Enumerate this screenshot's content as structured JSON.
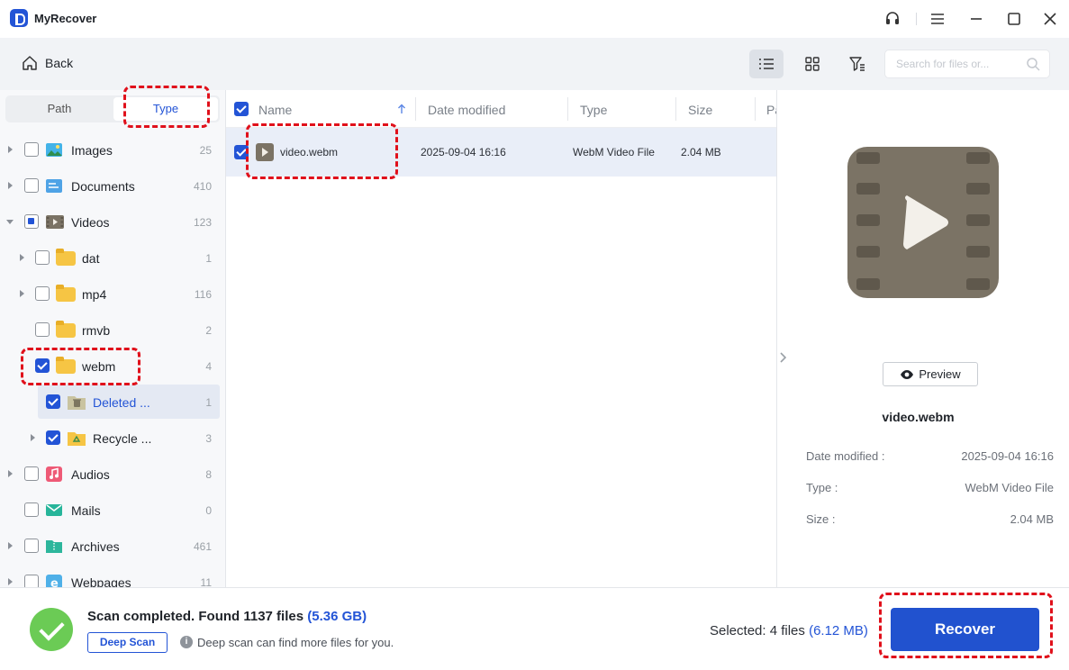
{
  "app": {
    "title": "MyRecover"
  },
  "toolbar": {
    "back_label": "Back",
    "search_placeholder": "Search for files or..."
  },
  "sidebar": {
    "tabs": [
      {
        "label": "Path",
        "active": false
      },
      {
        "label": "Type",
        "active": true
      }
    ],
    "items": [
      {
        "label": "Images",
        "count": "25",
        "icon": "images-icon",
        "level": 0,
        "checked": "none",
        "expanded": false
      },
      {
        "label": "Documents",
        "count": "410",
        "icon": "documents-icon",
        "level": 0,
        "checked": "none",
        "expanded": false
      },
      {
        "label": "Videos",
        "count": "123",
        "icon": "videos-icon",
        "level": 0,
        "checked": "partial",
        "expanded": true
      },
      {
        "label": "dat",
        "count": "1",
        "icon": "folder-icon",
        "level": 1,
        "checked": "none",
        "expanded": false
      },
      {
        "label": "mp4",
        "count": "116",
        "icon": "folder-icon",
        "level": 1,
        "checked": "none",
        "expanded": false
      },
      {
        "label": "rmvb",
        "count": "2",
        "icon": "folder-icon",
        "level": 1,
        "checked": "none",
        "expanded": false
      },
      {
        "label": "webm",
        "count": "4",
        "icon": "folder-icon",
        "level": 1,
        "checked": "checked",
        "expanded": true
      },
      {
        "label": "Deleted ...",
        "count": "1",
        "icon": "deleted-folder-icon",
        "level": 2,
        "checked": "checked",
        "selected": true
      },
      {
        "label": "Recycle ...",
        "count": "3",
        "icon": "recycle-folder-icon",
        "level": 2,
        "checked": "checked",
        "expanded": false
      },
      {
        "label": "Audios",
        "count": "8",
        "icon": "audios-icon",
        "level": 0,
        "checked": "none",
        "expanded": false
      },
      {
        "label": "Mails",
        "count": "0",
        "icon": "mails-icon",
        "level": 0,
        "checked": "none"
      },
      {
        "label": "Archives",
        "count": "461",
        "icon": "archives-icon",
        "level": 0,
        "checked": "none",
        "expanded": false
      },
      {
        "label": "Webpages",
        "count": "11",
        "icon": "webpages-icon",
        "level": 0,
        "checked": "none",
        "expanded": false
      }
    ]
  },
  "file_list": {
    "columns": [
      "Name",
      "Date modified",
      "Type",
      "Size",
      "Pa"
    ],
    "rows": [
      {
        "name": "video.webm",
        "date": "2025-09-04 16:16",
        "type": "WebM Video File",
        "size": "2.04 MB",
        "checked": true
      }
    ]
  },
  "preview": {
    "button_label": "Preview",
    "file_name": "video.webm",
    "details": [
      {
        "label": "Date modified :",
        "value": "2025-09-04 16:16"
      },
      {
        "label": "Type :",
        "value": "WebM Video File"
      },
      {
        "label": "Size :",
        "value": "2.04 MB"
      }
    ]
  },
  "status": {
    "scan_text": "Scan completed. Found 1137 files",
    "scan_size": "(5.36 GB)",
    "deep_scan_label": "Deep Scan",
    "deep_scan_tip": "Deep scan can find more files for you.",
    "selected_text": "Selected: 4 files",
    "selected_size": "(6.12 MB)",
    "recover_label": "Recover"
  },
  "colors": {
    "accent": "#2354d6",
    "success": "#6bcb55",
    "annotation": "#e0101b"
  }
}
